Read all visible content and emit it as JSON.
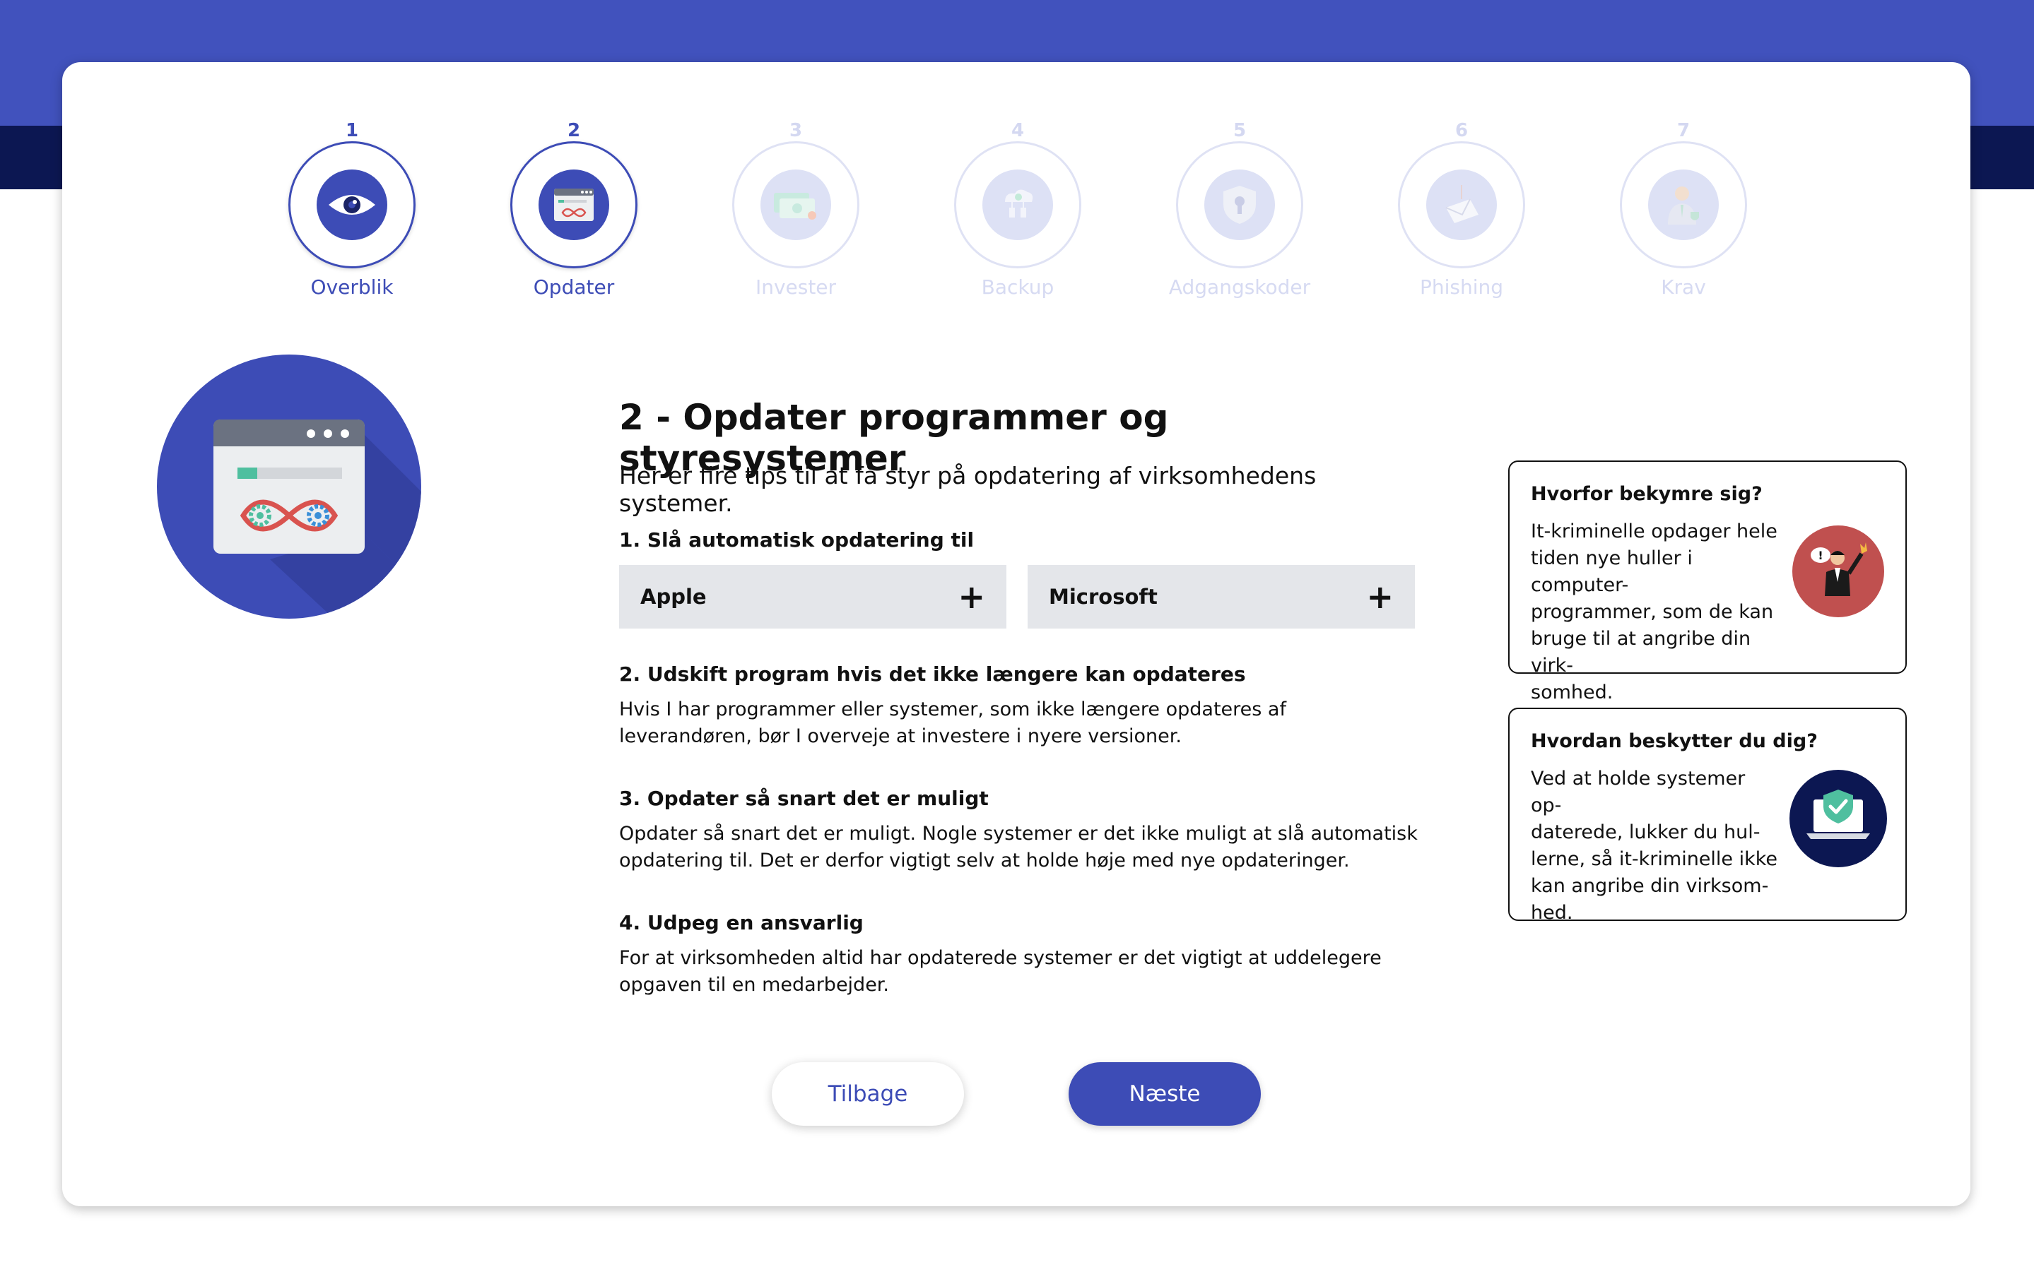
{
  "stepper": [
    {
      "num": "1",
      "label": "Overblik",
      "icon": "eye-icon",
      "state": "done"
    },
    {
      "num": "2",
      "label": "Opdater",
      "icon": "browser-window-icon",
      "state": "current"
    },
    {
      "num": "3",
      "label": "Invester",
      "icon": "money-icon",
      "state": "inactive"
    },
    {
      "num": "4",
      "label": "Backup",
      "icon": "cloud-backup-icon",
      "state": "inactive"
    },
    {
      "num": "5",
      "label": "Adgangskoder",
      "icon": "shield-keyhole-icon",
      "state": "inactive"
    },
    {
      "num": "6",
      "label": "Phishing",
      "icon": "phishing-hook-icon",
      "state": "inactive"
    },
    {
      "num": "7",
      "label": "Krav",
      "icon": "person-badge-icon",
      "state": "inactive"
    }
  ],
  "hero": {
    "icon": "browser-window-infinity-gears-icon"
  },
  "main": {
    "title": "2 - Opdater programmer og styresystemer",
    "intro": "Her er fire tips til at få styr på opdatering af virksomhedens systemer.",
    "tips": [
      {
        "heading": "1. Slå automatisk opdatering til"
      },
      {
        "heading": "2. Udskift program hvis det ikke længere kan opdateres",
        "text": "Hvis I har programmer eller systemer, som ikke længere opdateres af leverandøren, bør I overveje at investere i nyere versioner."
      },
      {
        "heading": "3. Opdater så snart det er muligt",
        "text": "Opdater så snart det er muligt. Nogle systemer er det ikke muligt at slå automatisk opdatering til. Det er derfor vigtigt selv at holde høje med nye opdateringer."
      },
      {
        "heading": "4. Udpeg en ansvarlig",
        "text": "For at virksomheden altid har opdaterede systemer er det vigtigt at uddelegere opgaven til en medarbejder."
      }
    ],
    "accordions": [
      {
        "label": "Apple",
        "icon": "plus-icon"
      },
      {
        "label": "Microsoft",
        "icon": "plus-icon"
      }
    ]
  },
  "buttons": {
    "back": "Tilbage",
    "next": "Næste"
  },
  "info": [
    {
      "heading": "Hvorfor bekymre sig?",
      "lines": [
        "It-kriminelle opdager hele",
        "tiden nye huller i computer-",
        "programmer, som de kan",
        "bruge til at angribe din virk-",
        "somhed."
      ],
      "icon": "hacker-icon"
    },
    {
      "heading": "Hvordan beskytter du dig?",
      "lines": [
        "Ved at holde systemer op-",
        "daterede, lukker du hul-",
        "lerne, så it-kriminelle ikke",
        "kan angribe din virksom-",
        "hed."
      ],
      "icon": "laptop-shield-icon"
    }
  ],
  "colors": {
    "primary": "#3d4cb6",
    "header": "#4152bd",
    "navy": "#0c1752",
    "accordion": "#e4e6ea"
  }
}
